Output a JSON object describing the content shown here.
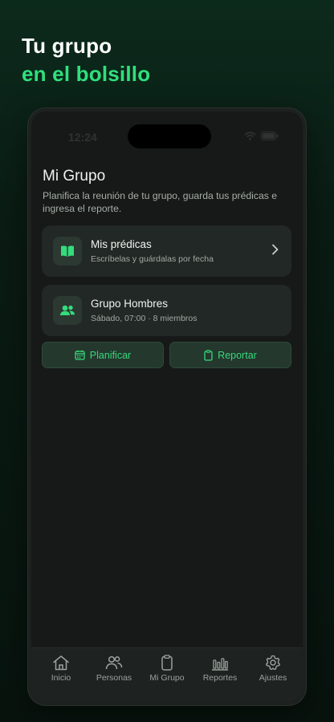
{
  "headline": {
    "line1": "Tu grupo",
    "line2": "en el bolsillo"
  },
  "status_bar": {
    "time": "12:24"
  },
  "page": {
    "title": "Mi Grupo",
    "subtitle": "Planifica la reunión de tu grupo, guarda tus prédicas e ingresa el reporte."
  },
  "cards": {
    "predicas": {
      "title": "Mis prédicas",
      "subtitle": "Escríbelas y guárdalas por fecha",
      "icon": "book-open-icon"
    },
    "grupo": {
      "title": "Grupo Hombres",
      "subtitle": "Sábado, 07:00 · 8 miembros",
      "icon": "users-icon"
    }
  },
  "actions": {
    "planificar": "Planificar",
    "reportar": "Reportar"
  },
  "tabs": [
    {
      "label": "Inicio",
      "icon": "home-icon"
    },
    {
      "label": "Personas",
      "icon": "people-icon"
    },
    {
      "label": "Mi Grupo",
      "icon": "clipboard-icon"
    },
    {
      "label": "Reportes",
      "icon": "bar-chart-icon"
    },
    {
      "label": "Ajustes",
      "icon": "gear-icon"
    }
  ],
  "colors": {
    "accent": "#2fe07c",
    "background": "#161917",
    "card": "#222825"
  }
}
